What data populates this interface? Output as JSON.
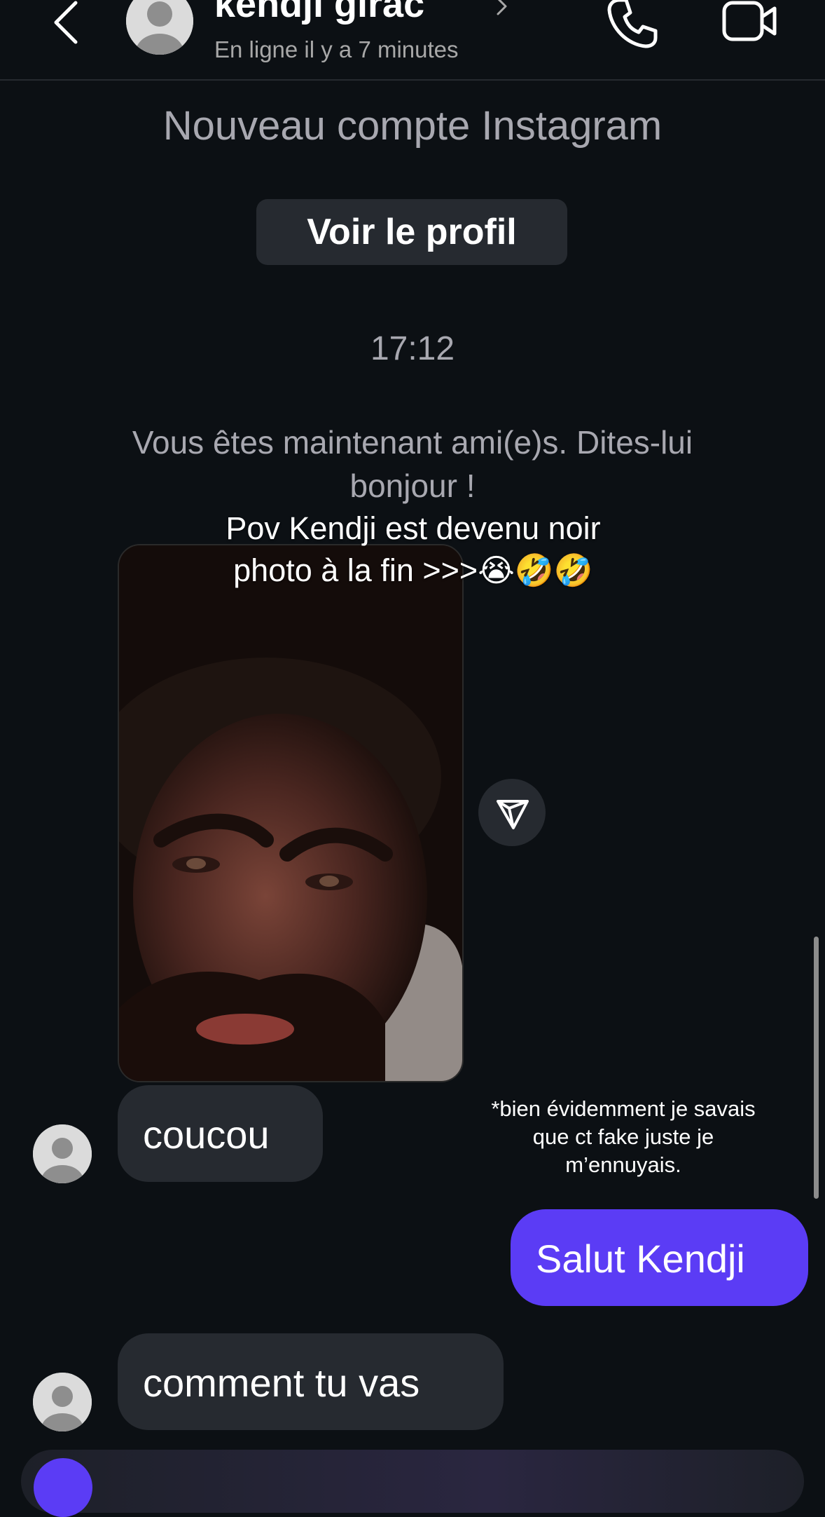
{
  "header": {
    "contact_name": "kendji girac",
    "status": "En ligne il y a 7 minutes"
  },
  "thread": {
    "system_title": "Nouveau compte Instagram",
    "view_profile_label": "Voir le profil",
    "timestamp": "17:12",
    "friends_note": "Vous êtes maintenant ami(e)s. Dites-lui bonjour !"
  },
  "overlay": {
    "caption_line1": "Pov Kendji est devenu noir",
    "caption_line2": "photo à la fin >>>😭🤣🤣",
    "side_note": "*bien évidemment je savais que ct fake juste je m’ennuyais."
  },
  "messages": [
    {
      "sender": "them",
      "text": "coucou"
    },
    {
      "sender": "me",
      "text": "Salut Kendji"
    },
    {
      "sender": "them",
      "text": "comment tu vas"
    }
  ],
  "colors": {
    "background": "#0c1014",
    "incoming_bubble": "#262a30",
    "outgoing_bubble": "#5b3cf5",
    "muted_text": "#a8a8b0"
  },
  "icons": {
    "back": "chevron-left-icon",
    "call": "phone-icon",
    "video": "video-camera-icon",
    "share": "send-icon",
    "avatar": "default-avatar-icon"
  }
}
